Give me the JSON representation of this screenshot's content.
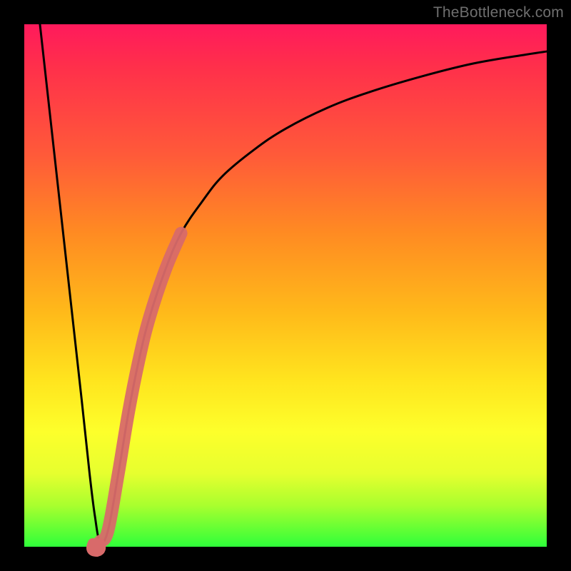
{
  "watermark": "TheBottleneck.com",
  "colors": {
    "background": "#000000",
    "curve": "#000000",
    "highlight": "#d86a6a",
    "gradient_stops": [
      "#ff1a5c",
      "#ff2f4b",
      "#ff5a39",
      "#ff8b22",
      "#ffb91a",
      "#ffe41e",
      "#fdff2b",
      "#e6ff2f",
      "#aaff2e",
      "#2fff3a"
    ]
  },
  "chart_data": {
    "type": "line",
    "title": "",
    "xlabel": "",
    "ylabel": "",
    "xlim": [
      0,
      100
    ],
    "ylim": [
      0,
      100
    ],
    "grid": false,
    "legend": false,
    "series": [
      {
        "name": "bottleneck-curve",
        "x": [
          3,
          5,
          7,
          9,
          11,
          12.5,
          13.5,
          14.5,
          16,
          18,
          20,
          22,
          24,
          27,
          30,
          34,
          38,
          44,
          50,
          58,
          66,
          76,
          86,
          96,
          100
        ],
        "y": [
          100,
          82,
          64,
          46,
          28,
          14,
          6,
          1,
          3,
          14,
          26,
          36,
          44,
          53,
          60,
          66,
          71,
          76,
          80,
          84,
          87,
          90,
          92.5,
          94.2,
          94.8
        ]
      },
      {
        "name": "highlight-segment",
        "x": [
          14.5,
          16,
          18,
          20,
          22,
          24,
          27,
          30
        ],
        "y": [
          1,
          3,
          14,
          26,
          36,
          44,
          53,
          60
        ]
      }
    ],
    "annotations": []
  }
}
